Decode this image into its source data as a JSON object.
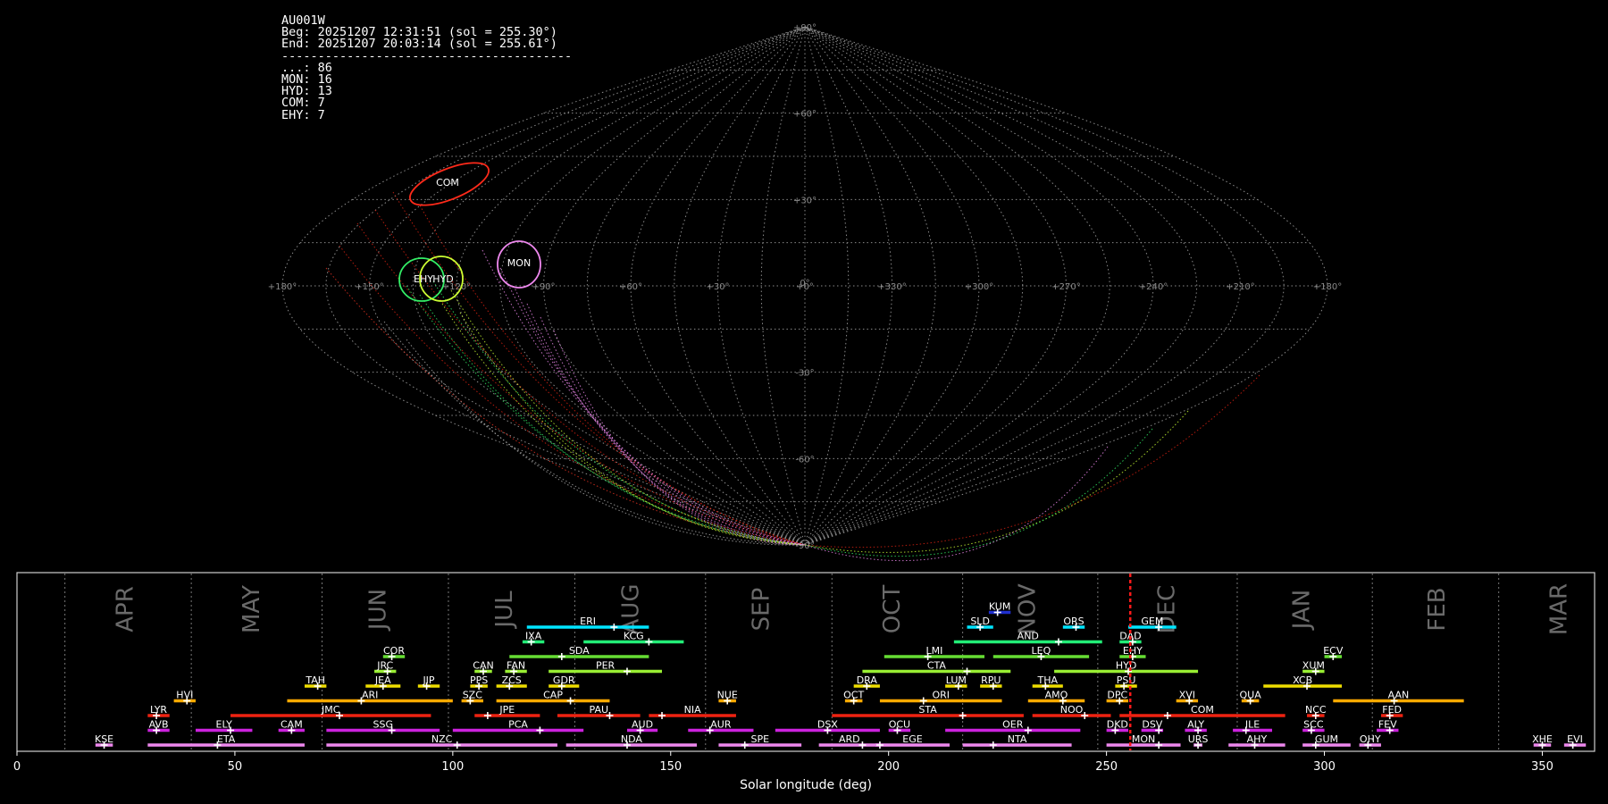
{
  "station_info": {
    "station": "AU001W",
    "begin": "Beg: 20251207 12:31:51 (sol = 255.30°)",
    "end": "End: 20251207 20:03:14 (sol = 255.61°)",
    "separator": "----------------------------------------",
    "counts": [
      {
        "code": "...",
        "count": 86
      },
      {
        "code": "MON",
        "count": 16
      },
      {
        "code": "HYD",
        "count": 13
      },
      {
        "code": "COM",
        "count": 7
      },
      {
        "code": "EHY",
        "count": 7
      }
    ]
  },
  "sky_map": {
    "projection": "sinusoidal",
    "lat_labels": [
      "+90°",
      "+60°",
      "+30°",
      "0°",
      "-30°",
      "-60°",
      "-90°"
    ],
    "lon_labels": [
      "+180°",
      "+150°",
      "+120°",
      "+90°",
      "+60°",
      "+30°",
      "+0°",
      "+330°",
      "+300°",
      "+270°",
      "+240°",
      "+210°",
      "+180°"
    ],
    "radiants": [
      {
        "name": "COM",
        "ra": 168,
        "dec": 38,
        "color": "#ff2a1a"
      },
      {
        "name": "MON",
        "ra": 100,
        "dec": 8,
        "color": "#ee88ee"
      },
      {
        "name": "EHY",
        "ra": 134,
        "dec": 2,
        "color": "#33ee66"
      },
      {
        "name": "HYD",
        "ra": 125,
        "dec": 2,
        "color": "#ccff33"
      }
    ]
  },
  "chart_data": {
    "type": "timeline",
    "xlabel": "Solar longitude (deg)",
    "xlim": [
      0,
      362
    ],
    "xticks": [
      0,
      50,
      100,
      150,
      200,
      250,
      300,
      350
    ],
    "current_sol": 255.45,
    "month_boundaries": [
      11,
      40,
      70,
      99,
      128,
      158,
      187,
      217,
      248,
      280,
      311,
      340
    ],
    "months": [
      {
        "label": "APR",
        "sol": 25
      },
      {
        "label": "MAY",
        "sol": 54
      },
      {
        "label": "JUN",
        "sol": 83
      },
      {
        "label": "JUL",
        "sol": 112
      },
      {
        "label": "AUG",
        "sol": 141
      },
      {
        "label": "SEP",
        "sol": 171
      },
      {
        "label": "OCT",
        "sol": 201
      },
      {
        "label": "NOV",
        "sol": 232
      },
      {
        "label": "DEC",
        "sol": 264
      },
      {
        "label": "JAN",
        "sol": 295
      },
      {
        "label": "FEB",
        "sol": 326
      },
      {
        "label": "MAR",
        "sol": 354
      }
    ],
    "showers": [
      {
        "code": "KUM",
        "start": 223,
        "end": 228,
        "peak": 225,
        "row": 9,
        "color": "#1f2fd0"
      },
      {
        "code": "ERI",
        "start": 117,
        "end": 145,
        "peak": 137,
        "row": 8,
        "color": "#00e5ff"
      },
      {
        "code": "SLD",
        "start": 218,
        "end": 224,
        "peak": 221,
        "row": 8,
        "color": "#00e5ff"
      },
      {
        "code": "ORS",
        "start": 240,
        "end": 245,
        "peak": 243,
        "row": 8,
        "color": "#00e5ff"
      },
      {
        "code": "GEM",
        "start": 255,
        "end": 266,
        "peak": 262,
        "row": 8,
        "color": "#00e5ff"
      },
      {
        "code": "IXA",
        "start": 116,
        "end": 121,
        "peak": 118,
        "row": 7,
        "color": "#22ee77"
      },
      {
        "code": "KCG",
        "start": 130,
        "end": 153,
        "peak": 145,
        "row": 7,
        "color": "#22ee77"
      },
      {
        "code": "AND",
        "start": 215,
        "end": 249,
        "peak": 239,
        "row": 7,
        "color": "#22ee77"
      },
      {
        "code": "DAD",
        "start": 253,
        "end": 258,
        "peak": 256,
        "row": 7,
        "color": "#22ee77"
      },
      {
        "code": "COR",
        "start": 84,
        "end": 89,
        "peak": 86,
        "row": 6,
        "color": "#66dd33"
      },
      {
        "code": "SDA",
        "start": 113,
        "end": 145,
        "peak": 125,
        "row": 6,
        "color": "#66dd33"
      },
      {
        "code": "LMI",
        "start": 199,
        "end": 222,
        "peak": 209,
        "row": 6,
        "color": "#66dd33"
      },
      {
        "code": "LEQ",
        "start": 224,
        "end": 246,
        "peak": 235,
        "row": 6,
        "color": "#66dd33"
      },
      {
        "code": "EHY",
        "start": 253,
        "end": 259,
        "peak": 256,
        "row": 6,
        "color": "#66dd33"
      },
      {
        "code": "ECV",
        "start": 300,
        "end": 304,
        "peak": 302,
        "row": 6,
        "color": "#66dd33"
      },
      {
        "code": "JRC",
        "start": 82,
        "end": 87,
        "peak": 85,
        "row": 5,
        "color": "#99ee33"
      },
      {
        "code": "CAN",
        "start": 105,
        "end": 109,
        "peak": 107,
        "row": 5,
        "color": "#99ee33"
      },
      {
        "code": "FAN",
        "start": 112,
        "end": 117,
        "peak": 114,
        "row": 5,
        "color": "#99ee33"
      },
      {
        "code": "PER",
        "start": 122,
        "end": 148,
        "peak": 140,
        "row": 5,
        "color": "#99ee33"
      },
      {
        "code": "CTA",
        "start": 194,
        "end": 228,
        "peak": 218,
        "row": 5,
        "color": "#99ee33"
      },
      {
        "code": "HYD",
        "start": 238,
        "end": 271,
        "peak": 255,
        "row": 5,
        "color": "#99ee33"
      },
      {
        "code": "XUM",
        "start": 295,
        "end": 300,
        "peak": 298,
        "row": 5,
        "color": "#99ee33"
      },
      {
        "code": "TAH",
        "start": 66,
        "end": 71,
        "peak": 69,
        "row": 4,
        "color": "#eedd00"
      },
      {
        "code": "JEA",
        "start": 80,
        "end": 88,
        "peak": 84,
        "row": 4,
        "color": "#eedd00"
      },
      {
        "code": "JIP",
        "start": 92,
        "end": 97,
        "peak": 94,
        "row": 4,
        "color": "#eedd00"
      },
      {
        "code": "PPS",
        "start": 104,
        "end": 108,
        "peak": 106,
        "row": 4,
        "color": "#eedd00"
      },
      {
        "code": "ZCS",
        "start": 110,
        "end": 117,
        "peak": 113,
        "row": 4,
        "color": "#eedd00"
      },
      {
        "code": "GDR",
        "start": 122,
        "end": 129,
        "peak": 125,
        "row": 4,
        "color": "#eedd00"
      },
      {
        "code": "DRA",
        "start": 192,
        "end": 198,
        "peak": 195,
        "row": 4,
        "color": "#eedd00"
      },
      {
        "code": "LUM",
        "start": 213,
        "end": 218,
        "peak": 216,
        "row": 4,
        "color": "#eedd00"
      },
      {
        "code": "RPU",
        "start": 221,
        "end": 226,
        "peak": 224,
        "row": 4,
        "color": "#eedd00"
      },
      {
        "code": "THA",
        "start": 233,
        "end": 240,
        "peak": 236,
        "row": 4,
        "color": "#eedd00"
      },
      {
        "code": "PSU",
        "start": 252,
        "end": 257,
        "peak": 254,
        "row": 4,
        "color": "#eedd00"
      },
      {
        "code": "XCB",
        "start": 286,
        "end": 304,
        "peak": 296,
        "row": 4,
        "color": "#eedd00"
      },
      {
        "code": "HVI",
        "start": 36,
        "end": 41,
        "peak": 39,
        "row": 3,
        "color": "#ffaa00"
      },
      {
        "code": "ARI",
        "start": 62,
        "end": 100,
        "peak": 79,
        "row": 3,
        "color": "#ffaa00"
      },
      {
        "code": "SZC",
        "start": 102,
        "end": 107,
        "peak": 104,
        "row": 3,
        "color": "#ffaa00"
      },
      {
        "code": "CAP",
        "start": 110,
        "end": 136,
        "peak": 127,
        "row": 3,
        "color": "#ffaa00"
      },
      {
        "code": "NUE",
        "start": 161,
        "end": 165,
        "peak": 163,
        "row": 3,
        "color": "#ffaa00"
      },
      {
        "code": "OCT",
        "start": 190,
        "end": 194,
        "peak": 192,
        "row": 3,
        "color": "#ffaa00"
      },
      {
        "code": "ORI",
        "start": 198,
        "end": 226,
        "peak": 208,
        "row": 3,
        "color": "#ffaa00"
      },
      {
        "code": "AMO",
        "start": 232,
        "end": 245,
        "peak": 240,
        "row": 3,
        "color": "#ffaa00"
      },
      {
        "code": "DPC",
        "start": 250,
        "end": 255,
        "peak": 253,
        "row": 3,
        "color": "#ffaa00"
      },
      {
        "code": "XVI",
        "start": 266,
        "end": 271,
        "peak": 269,
        "row": 3,
        "color": "#ffaa00"
      },
      {
        "code": "QUA",
        "start": 281,
        "end": 285,
        "peak": 283,
        "row": 3,
        "color": "#ffaa00"
      },
      {
        "code": "AAN",
        "start": 302,
        "end": 332,
        "peak": 316,
        "row": 3,
        "color": "#ffaa00"
      },
      {
        "code": "LYR",
        "start": 30,
        "end": 35,
        "peak": 32,
        "row": 2,
        "color": "#ee2211"
      },
      {
        "code": "JMC",
        "start": 49,
        "end": 95,
        "peak": 74,
        "row": 2,
        "color": "#ee2211"
      },
      {
        "code": "JPE",
        "start": 105,
        "end": 120,
        "peak": 108,
        "row": 2,
        "color": "#ee2211"
      },
      {
        "code": "PAU",
        "start": 124,
        "end": 143,
        "peak": 136,
        "row": 2,
        "color": "#ee2211"
      },
      {
        "code": "NIA",
        "start": 145,
        "end": 165,
        "peak": 148,
        "row": 2,
        "color": "#ee2211"
      },
      {
        "code": "STA",
        "start": 187,
        "end": 231,
        "peak": 217,
        "row": 2,
        "color": "#ee2211"
      },
      {
        "code": "NOO",
        "start": 233,
        "end": 251,
        "peak": 245,
        "row": 2,
        "color": "#ee2211"
      },
      {
        "code": "COM",
        "start": 253,
        "end": 291,
        "peak": 264,
        "row": 2,
        "color": "#ee2211"
      },
      {
        "code": "NCC",
        "start": 296,
        "end": 300,
        "peak": 298,
        "row": 2,
        "color": "#ee2211"
      },
      {
        "code": "FED",
        "start": 313,
        "end": 318,
        "peak": 315,
        "row": 2,
        "color": "#ee2211"
      },
      {
        "code": "AVB",
        "start": 30,
        "end": 35,
        "peak": 32,
        "row": 1,
        "color": "#cc22dd"
      },
      {
        "code": "ELY",
        "start": 41,
        "end": 54,
        "peak": 49,
        "row": 1,
        "color": "#cc22dd"
      },
      {
        "code": "CAM",
        "start": 60,
        "end": 66,
        "peak": 63,
        "row": 1,
        "color": "#cc22dd"
      },
      {
        "code": "SSG",
        "start": 71,
        "end": 97,
        "peak": 86,
        "row": 1,
        "color": "#cc22dd"
      },
      {
        "code": "PCA",
        "start": 100,
        "end": 130,
        "peak": 120,
        "row": 1,
        "color": "#cc22dd"
      },
      {
        "code": "AUD",
        "start": 140,
        "end": 147,
        "peak": 143,
        "row": 1,
        "color": "#cc22dd"
      },
      {
        "code": "AUR",
        "start": 154,
        "end": 169,
        "peak": 159,
        "row": 1,
        "color": "#cc22dd"
      },
      {
        "code": "DSX",
        "start": 174,
        "end": 198,
        "peak": 186,
        "row": 1,
        "color": "#cc22dd"
      },
      {
        "code": "OCU",
        "start": 200,
        "end": 205,
        "peak": 202,
        "row": 1,
        "color": "#cc22dd"
      },
      {
        "code": "OER",
        "start": 213,
        "end": 244,
        "peak": 232,
        "row": 1,
        "color": "#cc22dd"
      },
      {
        "code": "DKD",
        "start": 250,
        "end": 255,
        "peak": 252,
        "row": 1,
        "color": "#cc22dd"
      },
      {
        "code": "DSV",
        "start": 258,
        "end": 263,
        "peak": 262,
        "row": 1,
        "color": "#cc22dd"
      },
      {
        "code": "ALY",
        "start": 268,
        "end": 273,
        "peak": 271,
        "row": 1,
        "color": "#cc22dd"
      },
      {
        "code": "ILE",
        "start": 279,
        "end": 288,
        "peak": 282,
        "row": 1,
        "color": "#cc22dd"
      },
      {
        "code": "SCC",
        "start": 295,
        "end": 300,
        "peak": 297,
        "row": 1,
        "color": "#cc22dd"
      },
      {
        "code": "FEV",
        "start": 312,
        "end": 317,
        "peak": 315,
        "row": 1,
        "color": "#cc22dd"
      },
      {
        "code": "KSE",
        "start": 18,
        "end": 22,
        "peak": 20,
        "row": 0,
        "color": "#ee88ee"
      },
      {
        "code": "ETA",
        "start": 30,
        "end": 66,
        "peak": 46,
        "row": 0,
        "color": "#ee88ee"
      },
      {
        "code": "NZC",
        "start": 71,
        "end": 124,
        "peak": 101,
        "row": 0,
        "color": "#ee88ee"
      },
      {
        "code": "NDA",
        "start": 126,
        "end": 156,
        "peak": 140,
        "row": 0,
        "color": "#ee88ee"
      },
      {
        "code": "SPE",
        "start": 161,
        "end": 180,
        "peak": 167,
        "row": 0,
        "color": "#ee88ee"
      },
      {
        "code": "ARD",
        "start": 184,
        "end": 198,
        "peak": 194,
        "row": 0,
        "color": "#ee88ee"
      },
      {
        "code": "EGE",
        "start": 197,
        "end": 214,
        "peak": 198,
        "row": 0,
        "color": "#ee88ee"
      },
      {
        "code": "NTA",
        "start": 217,
        "end": 242,
        "peak": 224,
        "row": 0,
        "color": "#ee88ee"
      },
      {
        "code": "MON",
        "start": 250,
        "end": 267,
        "peak": 262,
        "row": 0,
        "color": "#ee88ee"
      },
      {
        "code": "URS",
        "start": 270,
        "end": 272,
        "peak": 271,
        "row": 0,
        "color": "#ee88ee"
      },
      {
        "code": "AHY",
        "start": 278,
        "end": 291,
        "peak": 284,
        "row": 0,
        "color": "#ee88ee"
      },
      {
        "code": "GUM",
        "start": 295,
        "end": 306,
        "peak": 298,
        "row": 0,
        "color": "#ee88ee"
      },
      {
        "code": "OHY",
        "start": 308,
        "end": 313,
        "peak": 310,
        "row": 0,
        "color": "#ee88ee"
      },
      {
        "code": "XHE",
        "start": 348,
        "end": 352,
        "peak": 350,
        "row": 0,
        "color": "#ee88ee"
      },
      {
        "code": "EVI",
        "start": 355,
        "end": 360,
        "peak": 357,
        "row": 0,
        "color": "#ee88ee"
      }
    ]
  }
}
